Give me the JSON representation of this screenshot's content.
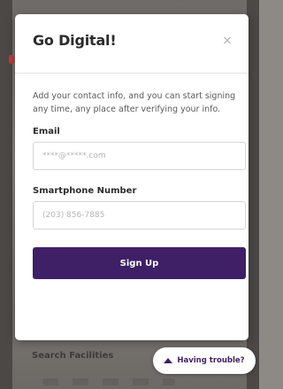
{
  "background": {
    "search_label": "Search Facilities"
  },
  "modal": {
    "title": "Go Digital!",
    "close_symbol": "×",
    "intro": "Add your contact info, and you can start signing any time, any place after verifying your info.",
    "email": {
      "label": "Email",
      "placeholder": "****@*****.com",
      "value": ""
    },
    "phone": {
      "label": "Smartphone Number",
      "placeholder": "(203) 856-7885",
      "value": ""
    },
    "signup_label": "Sign Up"
  },
  "help": {
    "label": "Having trouble?",
    "icon": "chevron-up-icon"
  },
  "colors": {
    "accent": "#3f1f66",
    "overlay": "#7a7774"
  }
}
